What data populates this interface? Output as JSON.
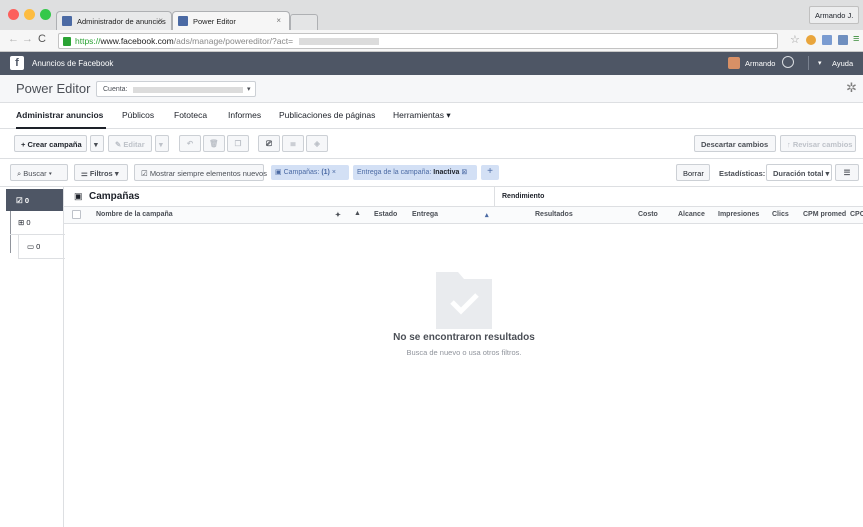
{
  "browser": {
    "tabs": [
      {
        "label": "Administrador de anuncios"
      },
      {
        "label": "Power Editor"
      }
    ],
    "user": "Armando J.",
    "url_prefix": "https://",
    "url_host": "www.facebook.com",
    "url_path": "/ads/manage/powereditor/?act="
  },
  "fbbar": {
    "title": "Anuncios de Facebook",
    "user": "Armando",
    "help": "Ayuda"
  },
  "header": {
    "title": "Power Editor",
    "account_label": "Cuenta:"
  },
  "nav": {
    "tabs": [
      "Administrar anuncios",
      "Públicos",
      "Fototeca",
      "Informes",
      "Publicaciones de páginas",
      "Herramientas"
    ]
  },
  "toolbar": {
    "create": "+ Crear campaña",
    "edit": "Editar",
    "discard": "Descartar cambios",
    "review": "Revisar cambios"
  },
  "filters": {
    "search": "Buscar",
    "filters": "Filtros",
    "show_always": "Mostrar siempre elementos nuevos",
    "chip1_label": "Campañas:",
    "chip1_value": "(1)",
    "chip2_label": "Entrega de la campaña:",
    "chip2_value": "Inactiva",
    "clear": "Borrar",
    "stats_label": "Estadísticas:",
    "stats_value": "Duración total"
  },
  "tree": {
    "campaigns_count": "0",
    "adsets_count": "0",
    "ads_count": "0"
  },
  "table": {
    "title": "Campañas",
    "perf": "Rendimiento",
    "columns": {
      "name": "Nombre de la campaña",
      "status": "Estado",
      "delivery": "Entrega",
      "results": "Resultados",
      "cost": "Costo",
      "reach": "Alcance",
      "impressions": "Impresiones",
      "clicks": "Clics",
      "cpm": "CPM promed",
      "cpc": "CPC"
    }
  },
  "empty": {
    "title": "No se encontraron resultados",
    "subtitle": "Busca de nuevo o usa otros filtros."
  }
}
